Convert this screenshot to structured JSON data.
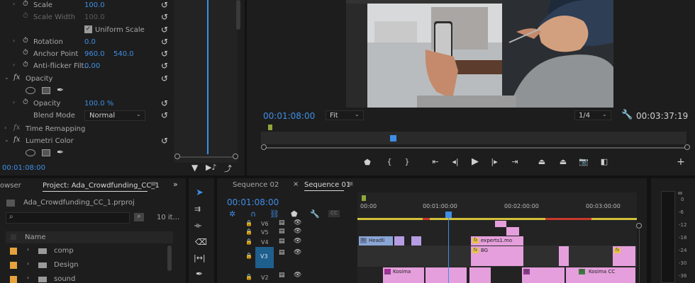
{
  "effect_controls": {
    "rows": [
      {
        "label": "Scale",
        "v1": "100.0"
      },
      {
        "label": "Scale Width",
        "v1": "100.0"
      },
      {
        "label": "Uniform Scale"
      },
      {
        "label": "Rotation",
        "v1": "0.0"
      },
      {
        "label": "Anchor Point",
        "v1": "960.0",
        "v2": "540.0"
      },
      {
        "label": "Anti-flicker Filt...",
        "v1": "0.00"
      },
      {
        "label": "Opacity"
      },
      {
        "label": "Opacity",
        "v1": "100.0 %"
      },
      {
        "label": "Blend Mode",
        "v1": "Normal"
      },
      {
        "label": "Time Remapping"
      },
      {
        "label": "Lumetri Color"
      }
    ],
    "timecode": "00:01:08:00"
  },
  "program": {
    "timecode": "00:01:08:00",
    "fit": "Fit",
    "resolution": "1/4",
    "duration": "00:03:37:19"
  },
  "project": {
    "tab_browser": "owser",
    "tab_project": "Project: Ada_Crowdfunding_CC_1",
    "file": "Ada_Crowdfunding_CC_1.prproj",
    "item_count": "10 it...",
    "name_header": "Name",
    "folders": [
      "comp",
      "Design",
      "sound"
    ]
  },
  "sequence": {
    "tab1": "Sequence 02",
    "tab2": "Sequence 01",
    "timecode": "00:01:08:00",
    "ruler": [
      "00:00",
      "00:01:00:00",
      "00:02:00:00",
      "00:03:00:00"
    ],
    "tracks": [
      "V6",
      "V5",
      "V4",
      "V3",
      "V2"
    ],
    "clips": [
      "Headli",
      "experts1.mo",
      "BG",
      "Kosima",
      "Kosima CC"
    ]
  },
  "meter": {
    "ticks": [
      "0",
      "-6",
      "-12",
      "-18",
      "-24",
      "-30",
      "-36"
    ]
  },
  "colors": {
    "accent": "#3e8ee6",
    "clip_pink": "#e59fdc",
    "clip_blue": "#8aa6d6",
    "clip_purple": "#b69de3"
  }
}
